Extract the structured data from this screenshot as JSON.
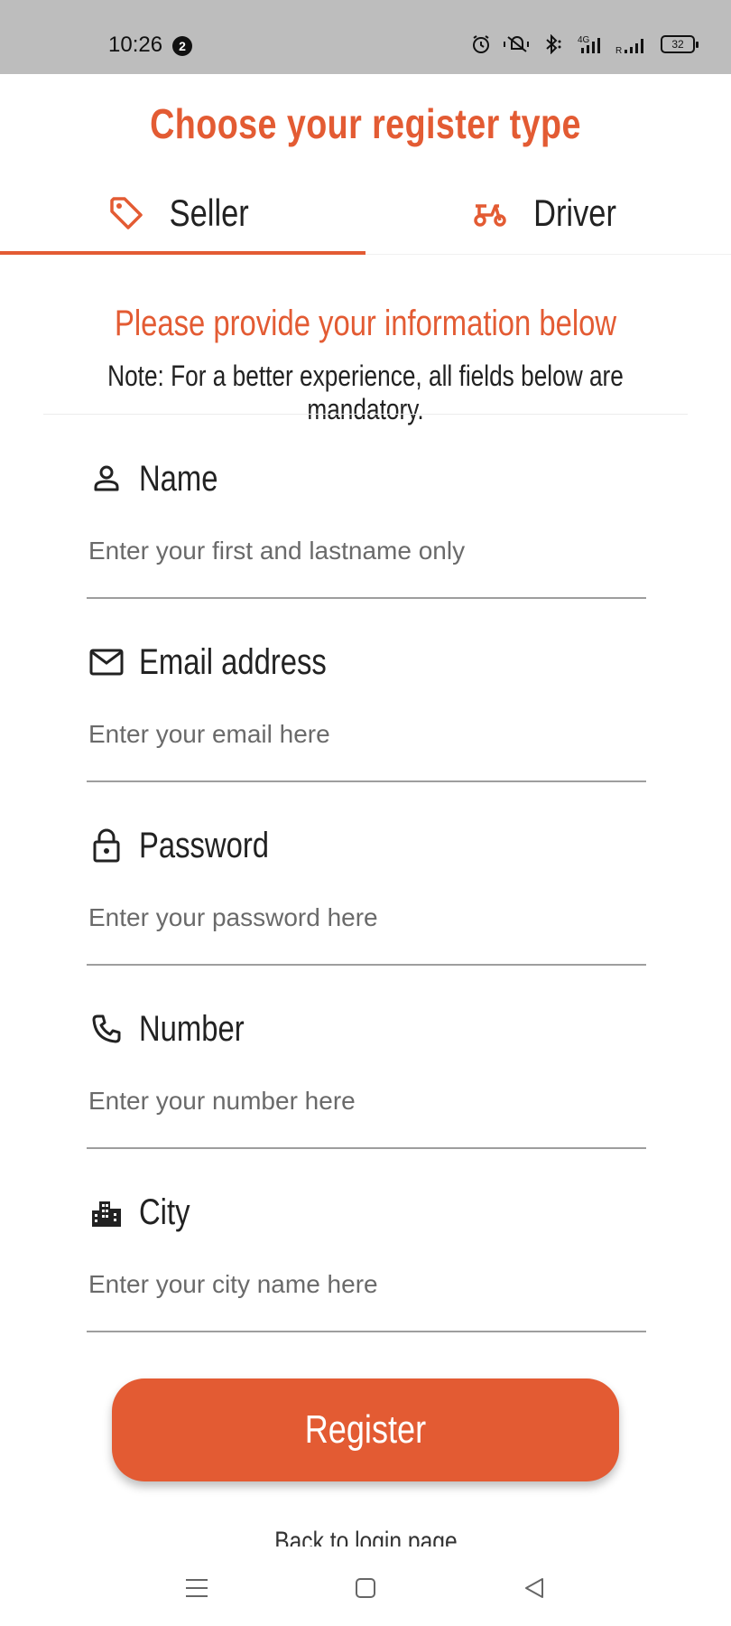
{
  "status_bar": {
    "time": "10:26",
    "notification_count": "2",
    "battery": "32",
    "icons": [
      "alarm-icon",
      "mute-icon",
      "bluetooth-icon",
      "signal-4g-icon",
      "signal-roaming-icon",
      "battery-icon"
    ]
  },
  "page": {
    "title": "Choose your register type"
  },
  "tabs": [
    {
      "label": "Seller",
      "icon": "tag-icon",
      "selected": true
    },
    {
      "label": "Driver",
      "icon": "scooter-icon",
      "selected": false
    }
  ],
  "info": {
    "title": "Please provide your information below",
    "note": "Note: For a better experience, all fields below are mandatory."
  },
  "form": {
    "name": {
      "label": "Name",
      "icon": "person-icon",
      "placeholder": "Enter your first and lastname only",
      "value": ""
    },
    "email": {
      "label": "Email address",
      "icon": "mail-icon",
      "placeholder": "Enter your email here",
      "value": ""
    },
    "password": {
      "label": "Password",
      "icon": "lock-icon",
      "placeholder": "Enter your password here",
      "value": ""
    },
    "number": {
      "label": "Number",
      "icon": "phone-icon",
      "placeholder": "Enter your number here",
      "value": ""
    },
    "city": {
      "label": "City",
      "icon": "city-icon",
      "placeholder": "Enter your city name here",
      "value": ""
    }
  },
  "actions": {
    "register_label": "Register",
    "back_label": "Back to login page"
  },
  "colors": {
    "accent": "#e35b33",
    "status_bar": "#bdbdbd"
  },
  "nav_bar": {
    "icons": [
      "menu-icon",
      "home-icon",
      "back-icon"
    ]
  }
}
